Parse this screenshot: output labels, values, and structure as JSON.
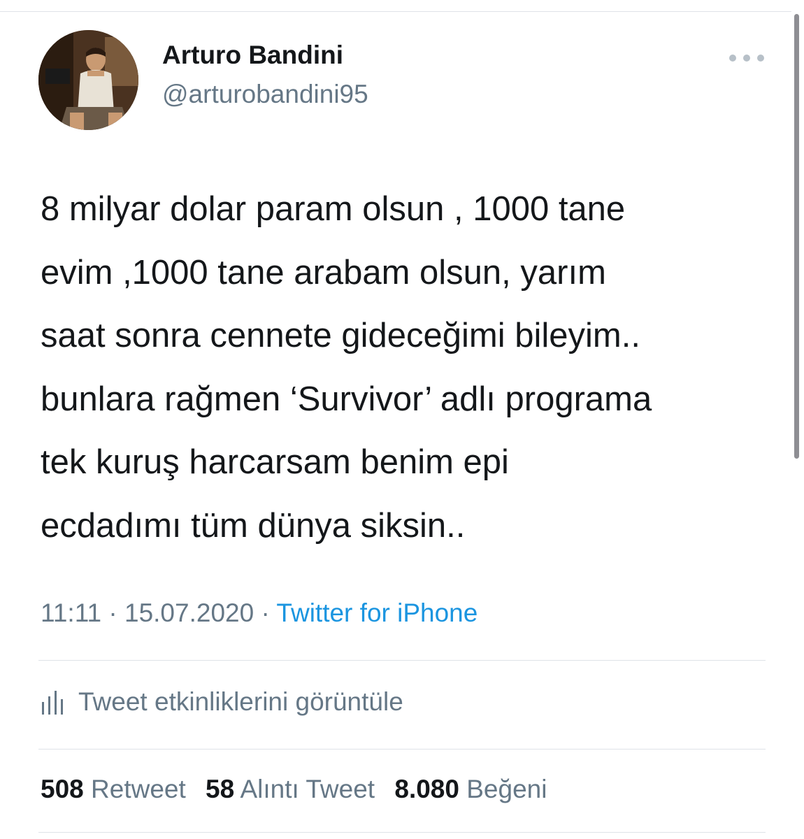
{
  "tweet": {
    "author": {
      "display_name": "Arturo Bandini",
      "handle": "@arturobandini95"
    },
    "text": "8 milyar dolar param olsun , 1000 tane\nevim ,1000 tane arabam olsun, yarım\nsaat sonra cennete gideceğimi bileyim..\nbunlara rağmen ‘Survivor’ adlı programa\ntek kuruş harcarsam benim epi\necdadımı tüm dünya siksin..",
    "time": "11:11",
    "separator": "·",
    "date": "15.07.2020",
    "source": "Twitter for iPhone",
    "activity_label": "Tweet etkinliklerini görüntüle",
    "stats": [
      {
        "count": "508",
        "label": "Retweet"
      },
      {
        "count": "58",
        "label": "Alıntı Tweet"
      },
      {
        "count": "8.080",
        "label": "Beğeni"
      }
    ]
  },
  "icons": {
    "more": "more-horizontal-icon",
    "activity": "bar-chart-icon"
  },
  "colors": {
    "text_primary": "#14171a",
    "text_secondary": "#657786",
    "link": "#1b95e0",
    "divider": "#dfe3e8"
  }
}
